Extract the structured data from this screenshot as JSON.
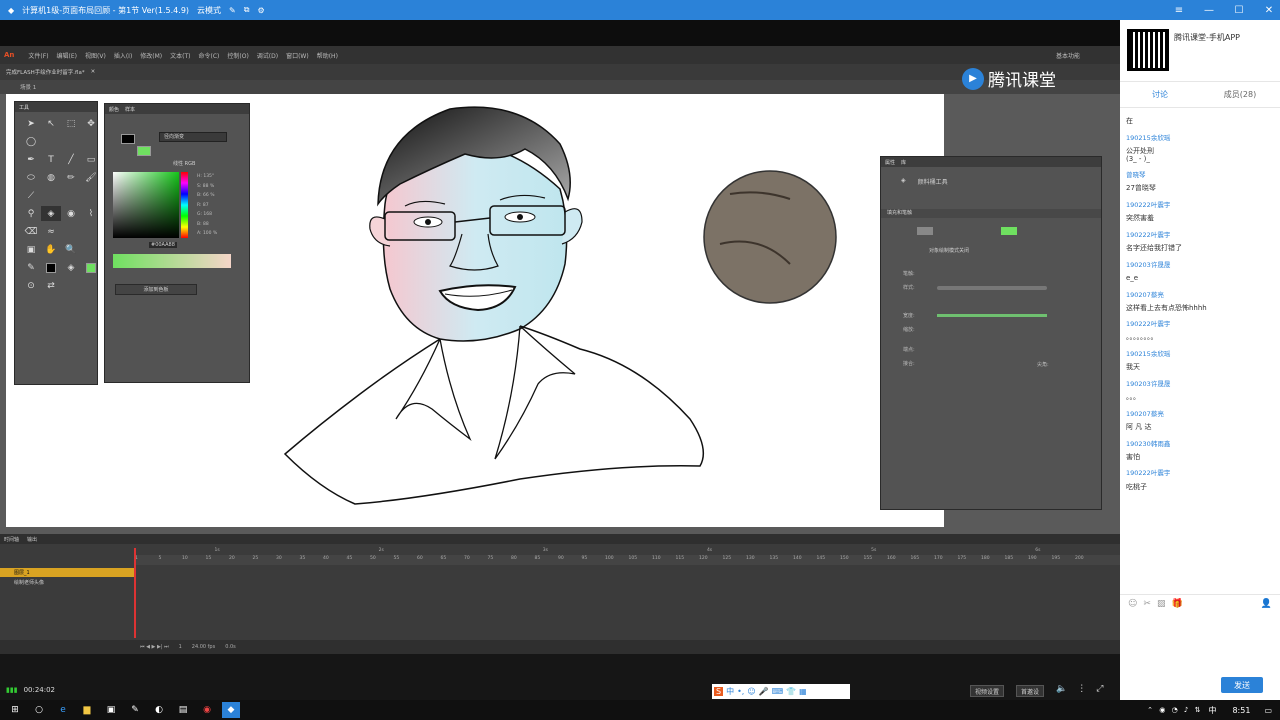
{
  "window": {
    "title": "计算机1级-页面布局回顾 - 第1节 Ver(1.5.4.9)",
    "mode": "云模式"
  },
  "menu": {
    "logo": "An",
    "items": [
      "文件(F)",
      "编辑(E)",
      "视图(V)",
      "插入(I)",
      "修改(M)",
      "文本(T)",
      "命令(C)",
      "控制(O)",
      "调试(D)",
      "窗口(W)",
      "帮助(H)"
    ],
    "workspace": "基本功能"
  },
  "doc_tab": "完成FLASH手绘作业时留字.fla*",
  "scene": "场景 1",
  "watermark": "腾讯课堂",
  "tools_panel": {
    "title": "工具"
  },
  "color_panel": {
    "tab1": "颜色",
    "tab2": "样本",
    "fill_type": "径向渐变",
    "linear_rgb": "线性 RGB",
    "hex": "#00AA88",
    "alpha": "100 %",
    "add_sample": "添加到色板",
    "h": "H: 135°",
    "s": "S: 88 %",
    "b": "B: 66 %",
    "r": "R: 87",
    "g": "G: 168",
    "bl": "B: 88",
    "a": "A: 100 %"
  },
  "props_panel": {
    "tab1": "属性",
    "tab2": "库",
    "tool_name": "颜料桶工具",
    "section": "填充和笔触",
    "stroke_hint": "对象绘制模式关闭",
    "labels": {
      "stroke": "笔触:",
      "style": "样式:",
      "width": "宽度:",
      "scale": "缩放:",
      "cap": "端点:",
      "join": "接合:",
      "sharp": "尖角:"
    }
  },
  "timeline": {
    "tab1": "时间轴",
    "tab2": "输出",
    "layers": [
      "图层_1",
      "绘制老师头像"
    ],
    "ruler": [
      "1",
      "5",
      "10",
      "15",
      "20",
      "25",
      "30",
      "35",
      "40",
      "45",
      "50",
      "55",
      "60",
      "65",
      "70",
      "75",
      "80",
      "85",
      "90",
      "95",
      "100",
      "105",
      "110",
      "115",
      "120",
      "125",
      "130",
      "135",
      "140",
      "145",
      "150",
      "155",
      "160",
      "165",
      "170",
      "175",
      "180",
      "185",
      "190",
      "195",
      "200"
    ],
    "seconds": [
      "1s",
      "2s",
      "3s",
      "4s",
      "5s",
      "6s"
    ],
    "fps": "24.00 fps",
    "time": "0.0s",
    "frame": "1"
  },
  "player": {
    "time": "00:24:02",
    "btn1": "视频设置",
    "btn2": "首邀设",
    "cn": "CH"
  },
  "chat": {
    "app": "腾讯课堂-手机APP",
    "tab_discuss": "讨论",
    "tab_members": "成员(28)",
    "send": "发送",
    "messages": [
      {
        "u": "",
        "t": "在"
      },
      {
        "u": "190215余欣瑶",
        "t": "公开处刑\n(3_ - )_"
      },
      {
        "u": "曾晓琴",
        "t": "27曾晓琴"
      },
      {
        "u": "190222叶震宇",
        "t": "突然害羞"
      },
      {
        "u": "190222叶震宇",
        "t": "名字还给我打错了"
      },
      {
        "u": "190203许晟晟",
        "t": "e_e"
      },
      {
        "u": "190207蔡亮",
        "t": "这样看上去有点恐怖hhhh"
      },
      {
        "u": "190222叶震宇",
        "t": "。。。。。。。。"
      },
      {
        "u": "190215余欣瑶",
        "t": "我天"
      },
      {
        "u": "190203许晟晟",
        "t": "。。。"
      },
      {
        "u": "190207蔡亮",
        "t": "阿 凡 达"
      },
      {
        "u": "190230韩雨鑫",
        "t": "害怕"
      },
      {
        "u": "190222叶震宇",
        "t": "吃桃子"
      }
    ]
  },
  "taskbar": {
    "time": "8:51",
    "ime": "中"
  }
}
